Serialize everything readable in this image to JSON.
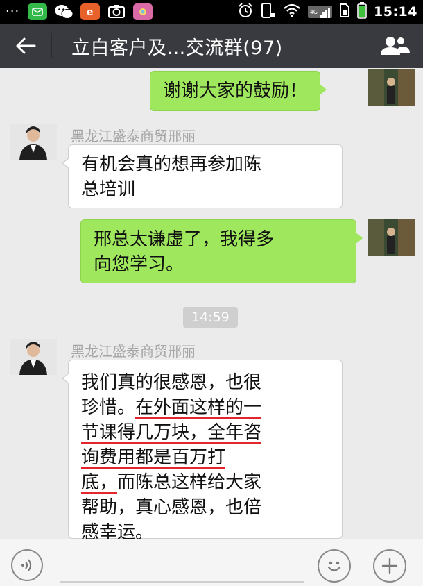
{
  "status_bar": {
    "time": "15:14",
    "network_label": "4G",
    "left_icons": [
      "more-dots-icon",
      "green-app-icon",
      "wechat-icon",
      "orange-browser-icon",
      "camera-icon",
      "pink-app-icon"
    ],
    "right_icons": [
      "alarm-icon",
      "nfc-icon",
      "wifi-icon",
      "signal-icon",
      "sim-icon",
      "battery-icon"
    ]
  },
  "header": {
    "title": "立白客户及...交流群(97)"
  },
  "messages": [
    {
      "direction": "out",
      "lines": [
        "谢谢大家的鼓励！"
      ]
    },
    {
      "direction": "in",
      "sender": "黑龙江盛泰商贸邢丽",
      "lines": [
        "有机会真的想再参加陈",
        "总培训"
      ]
    },
    {
      "direction": "out",
      "lines": [
        "邢总太谦虚了，我得多",
        "向您学习。"
      ]
    },
    {
      "type": "time",
      "text": "14:59"
    },
    {
      "direction": "in",
      "sender": "黑龙江盛泰商贸邢丽",
      "lines": [
        {
          "plain": "我们真的很感恩，也很",
          "under": ""
        },
        {
          "plain": "珍惜。",
          "under": "在外面这样的一"
        },
        {
          "plain": "",
          "under": "节课得几万块，全年咨"
        },
        {
          "plain": "",
          "under": "询费用都是百万打"
        },
        {
          "plain": "",
          "under": "底，",
          "tail": "而陈总这样给大家"
        },
        {
          "plain": "帮助，真心感恩，也倍",
          "under": ""
        },
        {
          "plain": "感幸运。",
          "under": ""
        }
      ]
    }
  ],
  "input": {
    "placeholder": ""
  },
  "colors": {
    "status_bar": "#000000",
    "title_bar": "#393a3f",
    "chat_bg": "#ebebeb",
    "bubble_out": "#9fe85e",
    "bubble_in": "#ffffff",
    "annotation_red": "#e3262b"
  }
}
